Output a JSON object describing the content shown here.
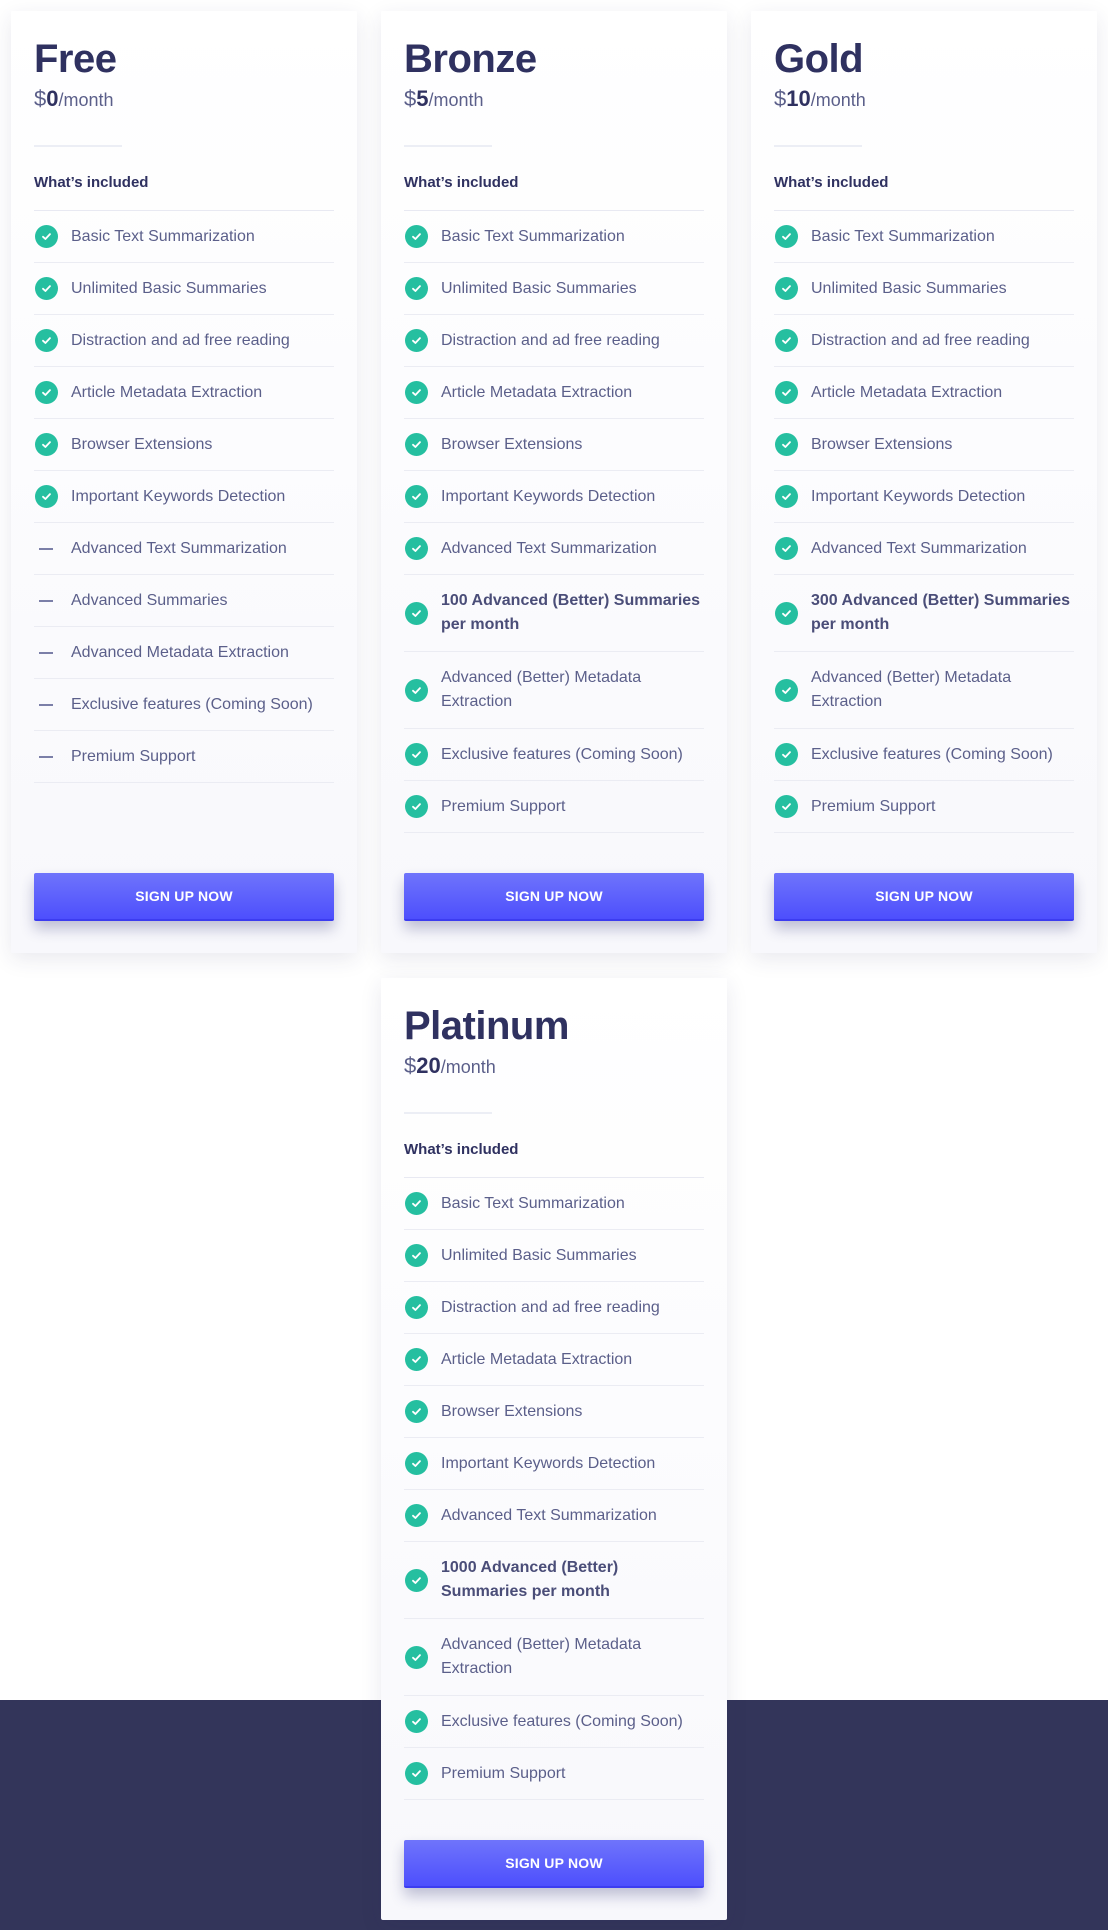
{
  "colors": {
    "accent": "#5053fc",
    "check": "#25bfa0",
    "heading": "#2f3160",
    "text": "#5b5f8a",
    "footer": "#33355a"
  },
  "section_label": "What's included",
  "plans": [
    {
      "name": "Free",
      "currency": "$",
      "amount": "0",
      "period": "/month",
      "included_label": "What’s included",
      "button": "SIGN UP NOW",
      "features": [
        {
          "text": "Basic Text Summarization",
          "included": true,
          "bold": false
        },
        {
          "text": "Unlimited Basic Summaries",
          "included": true,
          "bold": false
        },
        {
          "text": "Distraction and ad free reading",
          "included": true,
          "bold": false
        },
        {
          "text": "Article Metadata Extraction",
          "included": true,
          "bold": false
        },
        {
          "text": "Browser Extensions",
          "included": true,
          "bold": false
        },
        {
          "text": "Important Keywords Detection",
          "included": true,
          "bold": false
        },
        {
          "text": "Advanced Text Summarization",
          "included": false,
          "bold": false
        },
        {
          "text": "Advanced Summaries",
          "included": false,
          "bold": false
        },
        {
          "text": "Advanced Metadata Extraction",
          "included": false,
          "bold": false
        },
        {
          "text": "Exclusive features (Coming Soon)",
          "included": false,
          "bold": false
        },
        {
          "text": "Premium Support",
          "included": false,
          "bold": false
        }
      ]
    },
    {
      "name": "Bronze",
      "currency": "$",
      "amount": "5",
      "period": "/month",
      "included_label": "What’s included",
      "button": "SIGN UP NOW",
      "features": [
        {
          "text": "Basic Text Summarization",
          "included": true,
          "bold": false
        },
        {
          "text": "Unlimited Basic Summaries",
          "included": true,
          "bold": false
        },
        {
          "text": "Distraction and ad free reading",
          "included": true,
          "bold": false
        },
        {
          "text": "Article Metadata Extraction",
          "included": true,
          "bold": false
        },
        {
          "text": "Browser Extensions",
          "included": true,
          "bold": false
        },
        {
          "text": "Important Keywords Detection",
          "included": true,
          "bold": false
        },
        {
          "text": "Advanced Text Summarization",
          "included": true,
          "bold": false
        },
        {
          "text": "100 Advanced (Better) Summaries per month",
          "included": true,
          "bold": true
        },
        {
          "text": "Advanced (Better) Metadata Extraction",
          "included": true,
          "bold": false
        },
        {
          "text": "Exclusive features (Coming Soon)",
          "included": true,
          "bold": false
        },
        {
          "text": "Premium Support",
          "included": true,
          "bold": false
        }
      ]
    },
    {
      "name": "Gold",
      "currency": "$",
      "amount": "10",
      "period": "/month",
      "included_label": "What’s included",
      "button": "SIGN UP NOW",
      "features": [
        {
          "text": "Basic Text Summarization",
          "included": true,
          "bold": false
        },
        {
          "text": "Unlimited Basic Summaries",
          "included": true,
          "bold": false
        },
        {
          "text": "Distraction and ad free reading",
          "included": true,
          "bold": false
        },
        {
          "text": "Article Metadata Extraction",
          "included": true,
          "bold": false
        },
        {
          "text": "Browser Extensions",
          "included": true,
          "bold": false
        },
        {
          "text": "Important Keywords Detection",
          "included": true,
          "bold": false
        },
        {
          "text": "Advanced Text Summarization",
          "included": true,
          "bold": false
        },
        {
          "text": "300 Advanced (Better) Summaries per month",
          "included": true,
          "bold": true
        },
        {
          "text": "Advanced (Better) Metadata Extraction",
          "included": true,
          "bold": false
        },
        {
          "text": "Exclusive features (Coming Soon)",
          "included": true,
          "bold": false
        },
        {
          "text": "Premium Support",
          "included": true,
          "bold": false
        }
      ]
    },
    {
      "name": "Platinum",
      "currency": "$",
      "amount": "20",
      "period": "/month",
      "included_label": "What’s included",
      "button": "SIGN UP NOW",
      "features": [
        {
          "text": "Basic Text Summarization",
          "included": true,
          "bold": false
        },
        {
          "text": "Unlimited Basic Summaries",
          "included": true,
          "bold": false
        },
        {
          "text": "Distraction and ad free reading",
          "included": true,
          "bold": false
        },
        {
          "text": "Article Metadata Extraction",
          "included": true,
          "bold": false
        },
        {
          "text": "Browser Extensions",
          "included": true,
          "bold": false
        },
        {
          "text": "Important Keywords Detection",
          "included": true,
          "bold": false
        },
        {
          "text": "Advanced Text Summarization",
          "included": true,
          "bold": false
        },
        {
          "text": "1000 Advanced (Better) Summaries per month",
          "included": true,
          "bold": true
        },
        {
          "text": "Advanced (Better) Metadata Extraction",
          "included": true,
          "bold": false
        },
        {
          "text": "Exclusive features (Coming Soon)",
          "included": true,
          "bold": false
        },
        {
          "text": "Premium Support",
          "included": true,
          "bold": false
        }
      ]
    }
  ]
}
